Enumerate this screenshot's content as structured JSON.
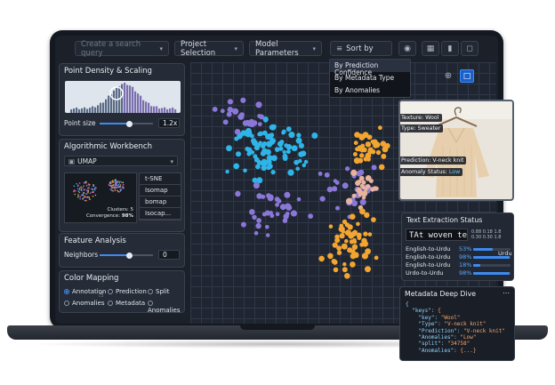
{
  "toolbar": {
    "search_placeholder": "Create a search query",
    "project_selection": "Project Selection",
    "model_parameters": "Model Parameters",
    "sort_by": "Sort by"
  },
  "sort_menu": [
    "By Prediction Confidence",
    "By Metadata Type",
    "By Anomalies"
  ],
  "density_panel": {
    "title": "Point Density & Scaling",
    "point_size_label": "Point size",
    "point_size_value": "1.2x",
    "point_size_level": 0.55
  },
  "workbench": {
    "title": "Algorithmic Workbench",
    "algorithm": "UMAP",
    "clusters_label": "Clusters:",
    "clusters_value": "5",
    "convergence_label": "Convergence:",
    "convergence_value": "98%",
    "methods": [
      "t-SNE",
      "Isomap",
      "bomap",
      "Isocap..."
    ]
  },
  "feature": {
    "title": "Feature Analysis",
    "neighbors_label": "Neighbors",
    "neighbors_value": "0",
    "neighbors_level": 0.55
  },
  "color_mapping": {
    "title": "Color Mapping",
    "options": [
      "Annotation",
      "Prediction",
      "Split",
      "Anomalies",
      "Metadata",
      "Anomalies"
    ],
    "selected": "Annotation"
  },
  "image_card": {
    "texture": "Texture: Wool",
    "type": "Type: Sweater",
    "prediction": "Prediction: V-neck knit",
    "anomaly_label": "Anomaly Status:",
    "anomaly_value": "Low"
  },
  "text_extraction": {
    "title": "Text Extraction Status",
    "sample": "TAt woven te",
    "mini_values": [
      "0.88  0.18  1.8",
      "0.30  0.30  1.8"
    ],
    "rows": [
      {
        "label": "English-to-Urdu",
        "pct": "53%",
        "value": 0.53,
        "extra": ""
      },
      {
        "label": "English-to-Urdu",
        "pct": "98%",
        "value": 0.98,
        "extra": "Urdu"
      },
      {
        "label": "English-to-Urdu",
        "pct": "18%",
        "value": 0.18,
        "extra": ""
      },
      {
        "label": "Urdo-to-Urdu",
        "pct": "98%",
        "value": 0.98,
        "extra": ""
      }
    ]
  },
  "metadata": {
    "title": "Metadata Deep Dive",
    "lines": [
      {
        "k": "{",
        "v": ""
      },
      {
        "k": "  \"keys\": ",
        "v": "{"
      },
      {
        "k": "    \"key\": ",
        "v": "\"Wool\""
      },
      {
        "k": "    \"Type\": ",
        "v": "\"V-neck knit\""
      },
      {
        "k": "    \"Prediction\": ",
        "v": "\"V-neck knit\""
      },
      {
        "k": "    \"Anomalies\": ",
        "v": "\"Low\""
      },
      {
        "k": "    \"split\": ",
        "v": "\"34758\""
      },
      {
        "k": "    \"Anomalies\": ",
        "v": "{...}"
      }
    ]
  },
  "colors": {
    "accent": "#3d8bf0",
    "cyan": "#2fb4e8",
    "purple": "#8a77d8",
    "orange": "#f2a530"
  }
}
